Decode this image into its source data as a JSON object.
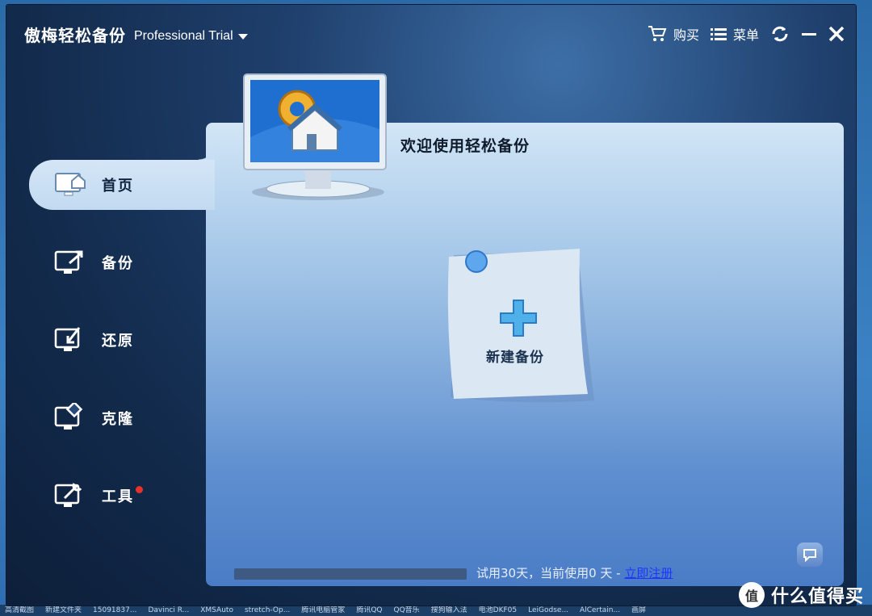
{
  "app": {
    "title": "傲梅轻松备份",
    "edition": "Professional Trial"
  },
  "toolbar": {
    "buy_label": "购买",
    "menu_label": "菜单"
  },
  "sidebar": {
    "items": [
      {
        "label": "首页",
        "active": true
      },
      {
        "label": "备份",
        "active": false
      },
      {
        "label": "还原",
        "active": false
      },
      {
        "label": "克隆",
        "active": false
      },
      {
        "label": "工具",
        "active": false,
        "notification": true
      }
    ]
  },
  "main": {
    "welcome": "欢迎使用轻松备份",
    "new_backup_label": "新建备份"
  },
  "status": {
    "trial_text": "试用30天，当前使用0 天 - ",
    "register_link": "立即注册"
  },
  "taskbar": {
    "items": [
      "高清截图",
      "新建文件夹",
      "15091837...",
      "Davinci R...",
      "XMSAuto",
      "stretch-Op...",
      "腾讯电脑管家",
      "腾讯QQ",
      "QQ音乐",
      "搜狗输入法",
      "电池DKF05",
      "LeiGodse...",
      "AlCertain...",
      "画屏"
    ]
  },
  "watermark": {
    "text": "什么值得买",
    "badge": "值"
  },
  "colors": {
    "accent_link": "#1e35ff",
    "notification": "#e8312a"
  }
}
